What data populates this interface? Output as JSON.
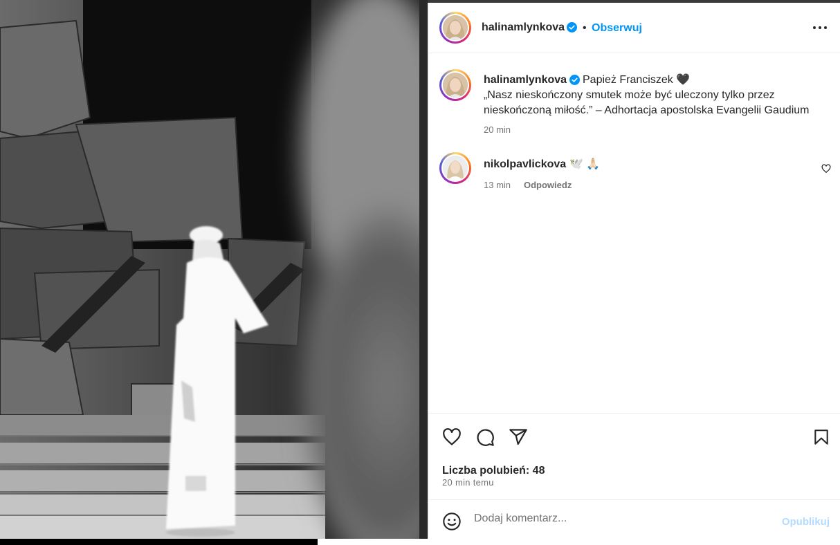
{
  "post": {
    "image_alt": "Papież Franciszek",
    "author": {
      "username": "halinamlynkova",
      "verified": true,
      "follow_label": "Obserwuj",
      "separator": "•"
    },
    "more_icon": "more-horizontal-icon",
    "caption": {
      "username": "halinamlynkova",
      "line1": "Papież Franciszek 🖤",
      "line2": "„Nasz nieskończony smutek może być uleczony tylko przez",
      "line3": "nieskończoną miłość.” – Adhortacja apostolska Evangelii Gaudium",
      "time": "20 min"
    },
    "comments": [
      {
        "username": "nikolpavlickova",
        "text": "🕊️ 🙏🏻",
        "time": "13 min",
        "reply_label": "Odpowiedz",
        "like_icon": "heart-small-icon"
      }
    ],
    "actions": {
      "like_icon": "heart-icon",
      "comment_icon": "comment-icon",
      "share_icon": "send-icon",
      "save_icon": "bookmark-icon"
    },
    "likes_label": "Liczba polubień: 48",
    "time_ago": "20 min temu",
    "comment_box": {
      "emoji_icon": "emoji-icon",
      "placeholder": "Dodaj komentarz...",
      "publish_label": "Opublikuj"
    }
  },
  "colors": {
    "accent": "#0095f6",
    "publish_disabled": "#b3dbff",
    "text": "#262626",
    "muted": "#737373"
  }
}
